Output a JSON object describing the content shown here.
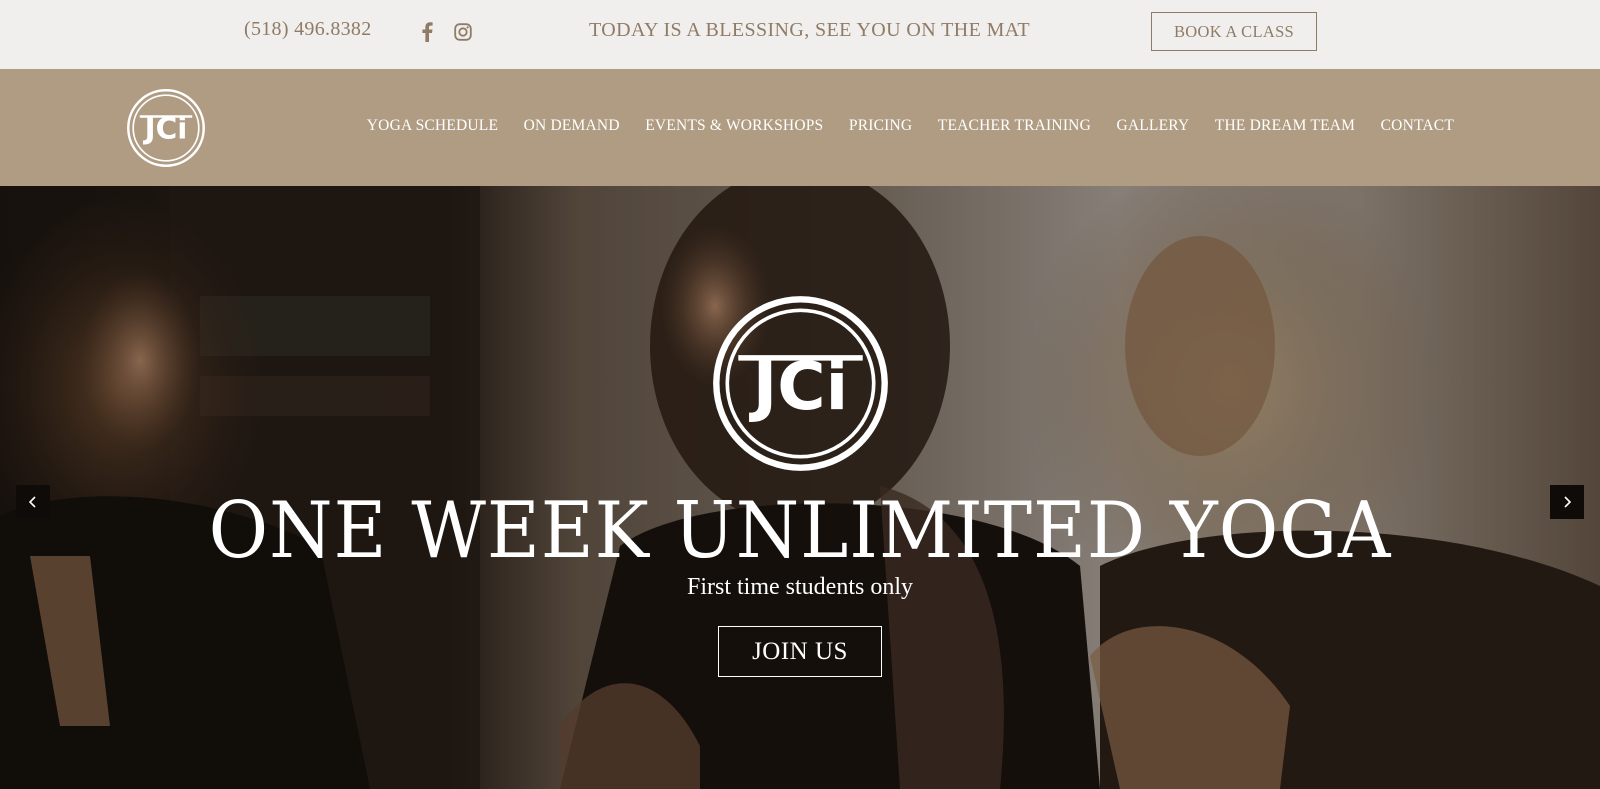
{
  "topbar": {
    "phone": "(518) 496.8382",
    "social": [
      {
        "icon": "facebook-icon"
      },
      {
        "icon": "instagram-icon"
      }
    ],
    "tagline": "TODAY IS A BLESSING, SEE YOU ON THE MAT",
    "book_label": "BOOK A CLASS"
  },
  "nav": {
    "logo_text": "JCi",
    "items": [
      {
        "label": "YOGA SCHEDULE"
      },
      {
        "label": "ON DEMAND"
      },
      {
        "label": "EVENTS & WORKSHOPS"
      },
      {
        "label": "PRICING"
      },
      {
        "label": "TEACHER TRAINING"
      },
      {
        "label": "GALLERY"
      },
      {
        "label": "THE DREAM TEAM"
      },
      {
        "label": "CONTACT"
      }
    ]
  },
  "hero": {
    "logo_text": "JCi",
    "headline": "ONE WEEK UNLIMITED YOGA",
    "subhead": "First time students only",
    "cta_label": "JOIN US",
    "prev_icon": "chevron-left-icon",
    "next_icon": "chevron-right-icon"
  },
  "colors": {
    "topbar_bg": "#f1efed",
    "accent_text": "#8f7b66",
    "nav_bg": "#b09c83",
    "hero_text": "#ffffff"
  }
}
